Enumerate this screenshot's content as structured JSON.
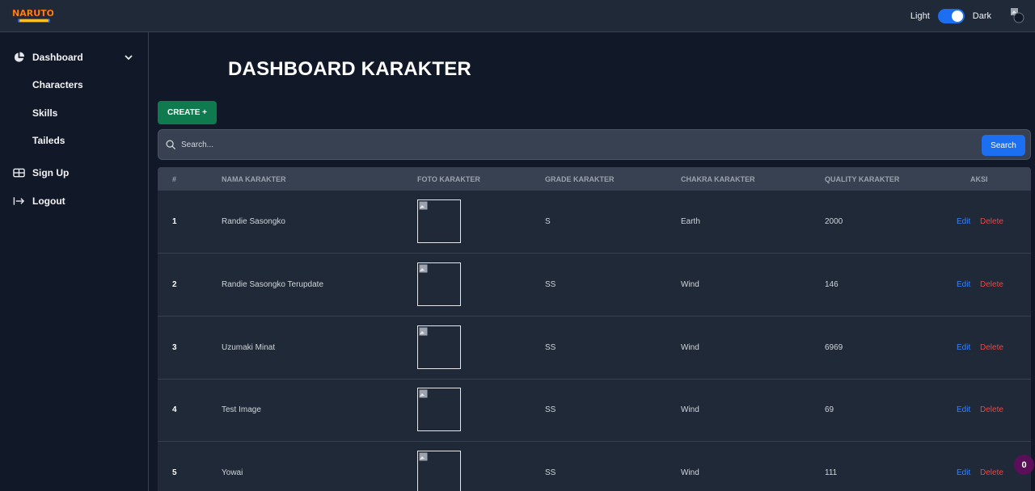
{
  "header": {
    "theme_light_label": "Light",
    "theme_dark_label": "Dark",
    "theme_mode": "dark",
    "accent_color": "#1d6ff2"
  },
  "sidebar": {
    "items": [
      {
        "label": "Dashboard",
        "icon": "pie-chart-icon",
        "expandable": true
      },
      {
        "label": "Characters",
        "icon": ""
      },
      {
        "label": "Skills",
        "icon": ""
      },
      {
        "label": "Taileds",
        "icon": ""
      },
      {
        "label": "Sign Up",
        "icon": "table-icon"
      },
      {
        "label": "Logout",
        "icon": "logout-arrow-icon"
      }
    ]
  },
  "main": {
    "title": "DASHBOARD KARAKTER",
    "create_label": "CREATE +",
    "search": {
      "placeholder": "Search...",
      "button_label": "Search"
    },
    "table": {
      "headers": [
        "#",
        "NAMA KARAKTER",
        "FOTO KARAKTER",
        "GRADE KARAKTER",
        "CHAKRA KARAKTER",
        "QUALITY KARAKTER",
        "AKSI"
      ],
      "rows": [
        {
          "no": "1",
          "nama": "Randie Sasongko",
          "grade": "S",
          "chakra": "Earth",
          "quality": "2000",
          "edit": "Edit",
          "delete": "Delete"
        },
        {
          "no": "2",
          "nama": "Randie Sasongko Terupdate",
          "grade": "SS",
          "chakra": "Wind",
          "quality": "146",
          "edit": "Edit",
          "delete": "Delete"
        },
        {
          "no": "3",
          "nama": "Uzumaki Minat",
          "grade": "SS",
          "chakra": "Wind",
          "quality": "6969",
          "edit": "Edit",
          "delete": "Delete"
        },
        {
          "no": "4",
          "nama": "Test Image",
          "grade": "SS",
          "chakra": "Wind",
          "quality": "69",
          "edit": "Edit",
          "delete": "Delete"
        },
        {
          "no": "5",
          "nama": "Yowai",
          "grade": "SS",
          "chakra": "Wind",
          "quality": "111",
          "edit": "Edit",
          "delete": "Delete"
        }
      ]
    },
    "notification_count": "0"
  }
}
